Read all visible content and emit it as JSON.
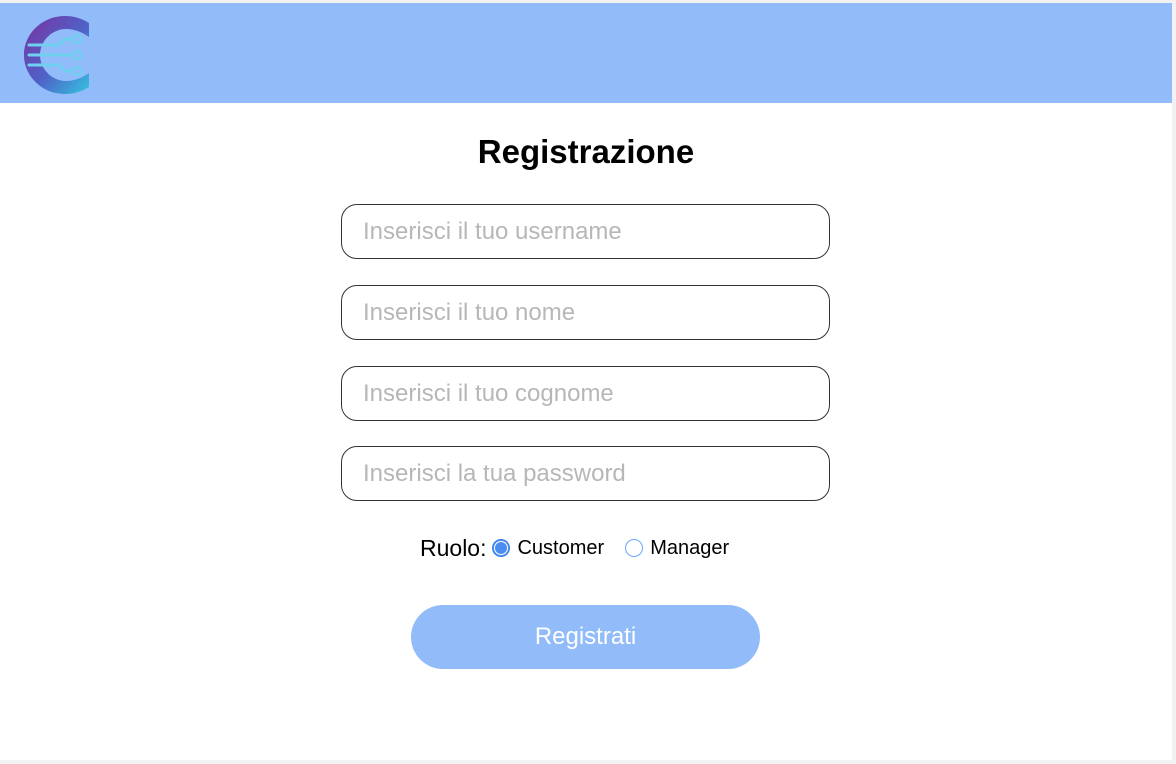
{
  "header": {
    "logo_icon": "circuit-c-logo",
    "background_color": "#91bbf9"
  },
  "form": {
    "title": "Registrazione",
    "fields": {
      "username": {
        "placeholder": "Inserisci il tuo username",
        "value": ""
      },
      "first_name": {
        "placeholder": "Inserisci il tuo nome",
        "value": ""
      },
      "last_name": {
        "placeholder": "Inserisci il tuo cognome",
        "value": ""
      },
      "password": {
        "placeholder": "Inserisci la tua password",
        "value": ""
      }
    },
    "role": {
      "label": "Ruolo:",
      "options": [
        {
          "label": "Customer",
          "selected": true
        },
        {
          "label": "Manager",
          "selected": false
        }
      ]
    },
    "submit_label": "Registrati",
    "accent_color": "#4a8ef0"
  }
}
